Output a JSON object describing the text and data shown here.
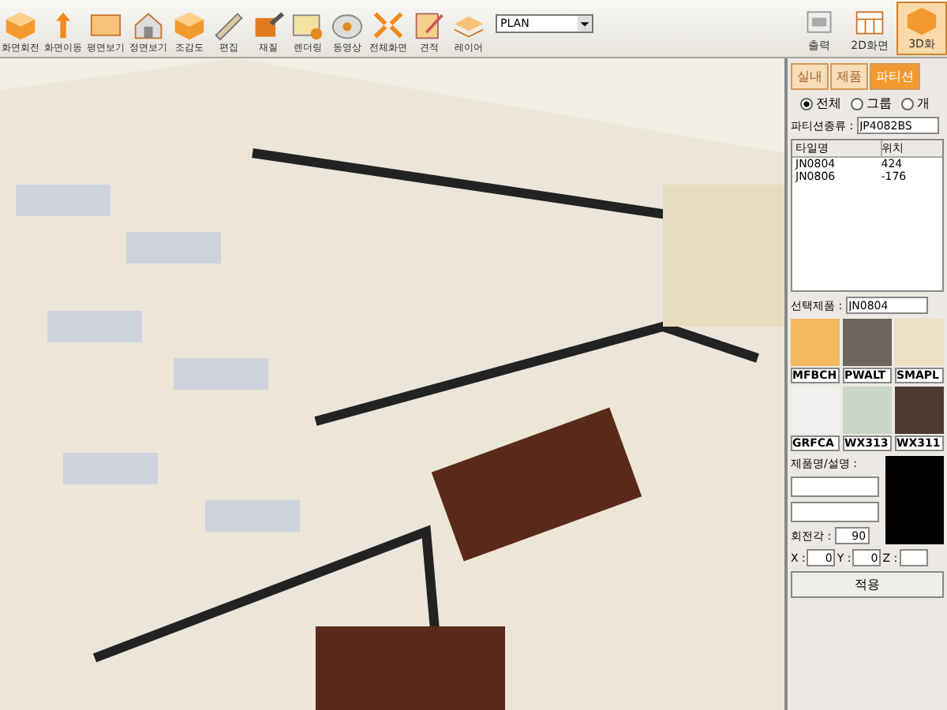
{
  "toolbar": {
    "tools": [
      {
        "label": "화면회전",
        "kind": "box"
      },
      {
        "label": "화면이동",
        "kind": "move"
      },
      {
        "label": "평면보기",
        "kind": "plan"
      },
      {
        "label": "정면보기",
        "kind": "house"
      },
      {
        "label": "조감도",
        "kind": "box"
      },
      {
        "label": "편집",
        "kind": "ruler"
      },
      {
        "label": "재질",
        "kind": "brush"
      },
      {
        "label": "렌더링",
        "kind": "picture"
      },
      {
        "label": "동영상",
        "kind": "reel"
      },
      {
        "label": "전체화면",
        "kind": "expand"
      },
      {
        "label": "견적",
        "kind": "note"
      },
      {
        "label": "레이어",
        "kind": "layers"
      }
    ],
    "layer_select": {
      "value": "PLAN"
    },
    "right_tools": [
      {
        "label": "출력",
        "kind": "printer",
        "selected": false
      },
      {
        "label": "2D화면",
        "kind": "calendar",
        "selected": false
      },
      {
        "label": "3D화",
        "kind": "box",
        "selected": true
      }
    ]
  },
  "panel": {
    "tabs": [
      {
        "label": "실내",
        "selected": false
      },
      {
        "label": "제품",
        "selected": false
      },
      {
        "label": "파티션",
        "selected": true
      }
    ],
    "radios": [
      {
        "label": "전체",
        "selected": true
      },
      {
        "label": "그룹",
        "selected": false
      },
      {
        "label": "개",
        "selected": false
      }
    ],
    "type_label": "파티션종류 :",
    "type_value": "JP4082BS",
    "table": {
      "columns": [
        "타일명",
        "위치"
      ],
      "rows": [
        [
          "JN0804",
          "424"
        ],
        [
          "JN0806",
          "-176"
        ]
      ]
    },
    "selected_label": "선택제품 :",
    "selected_value": "JN0804",
    "swatches": [
      {
        "label": "MFBCH",
        "color": "#f2b860"
      },
      {
        "label": "PWALT",
        "color": "#6e655c"
      },
      {
        "label": "SMAPL",
        "color": "#eee0c4"
      },
      {
        "label": "GRFCA",
        "color": "#f0f0ee"
      },
      {
        "label": "WX313",
        "color": "#c9d6c8"
      },
      {
        "label": "WX311",
        "color": "#4e3a32"
      }
    ],
    "desc_label": "제품명/설명 :",
    "angle_label": "회전각 :",
    "angle_value": "90",
    "coords": [
      {
        "label": "X :",
        "value": "0"
      },
      {
        "label": "Y :",
        "value": "0"
      },
      {
        "label": "Z :"
      }
    ],
    "apply": "적용"
  }
}
